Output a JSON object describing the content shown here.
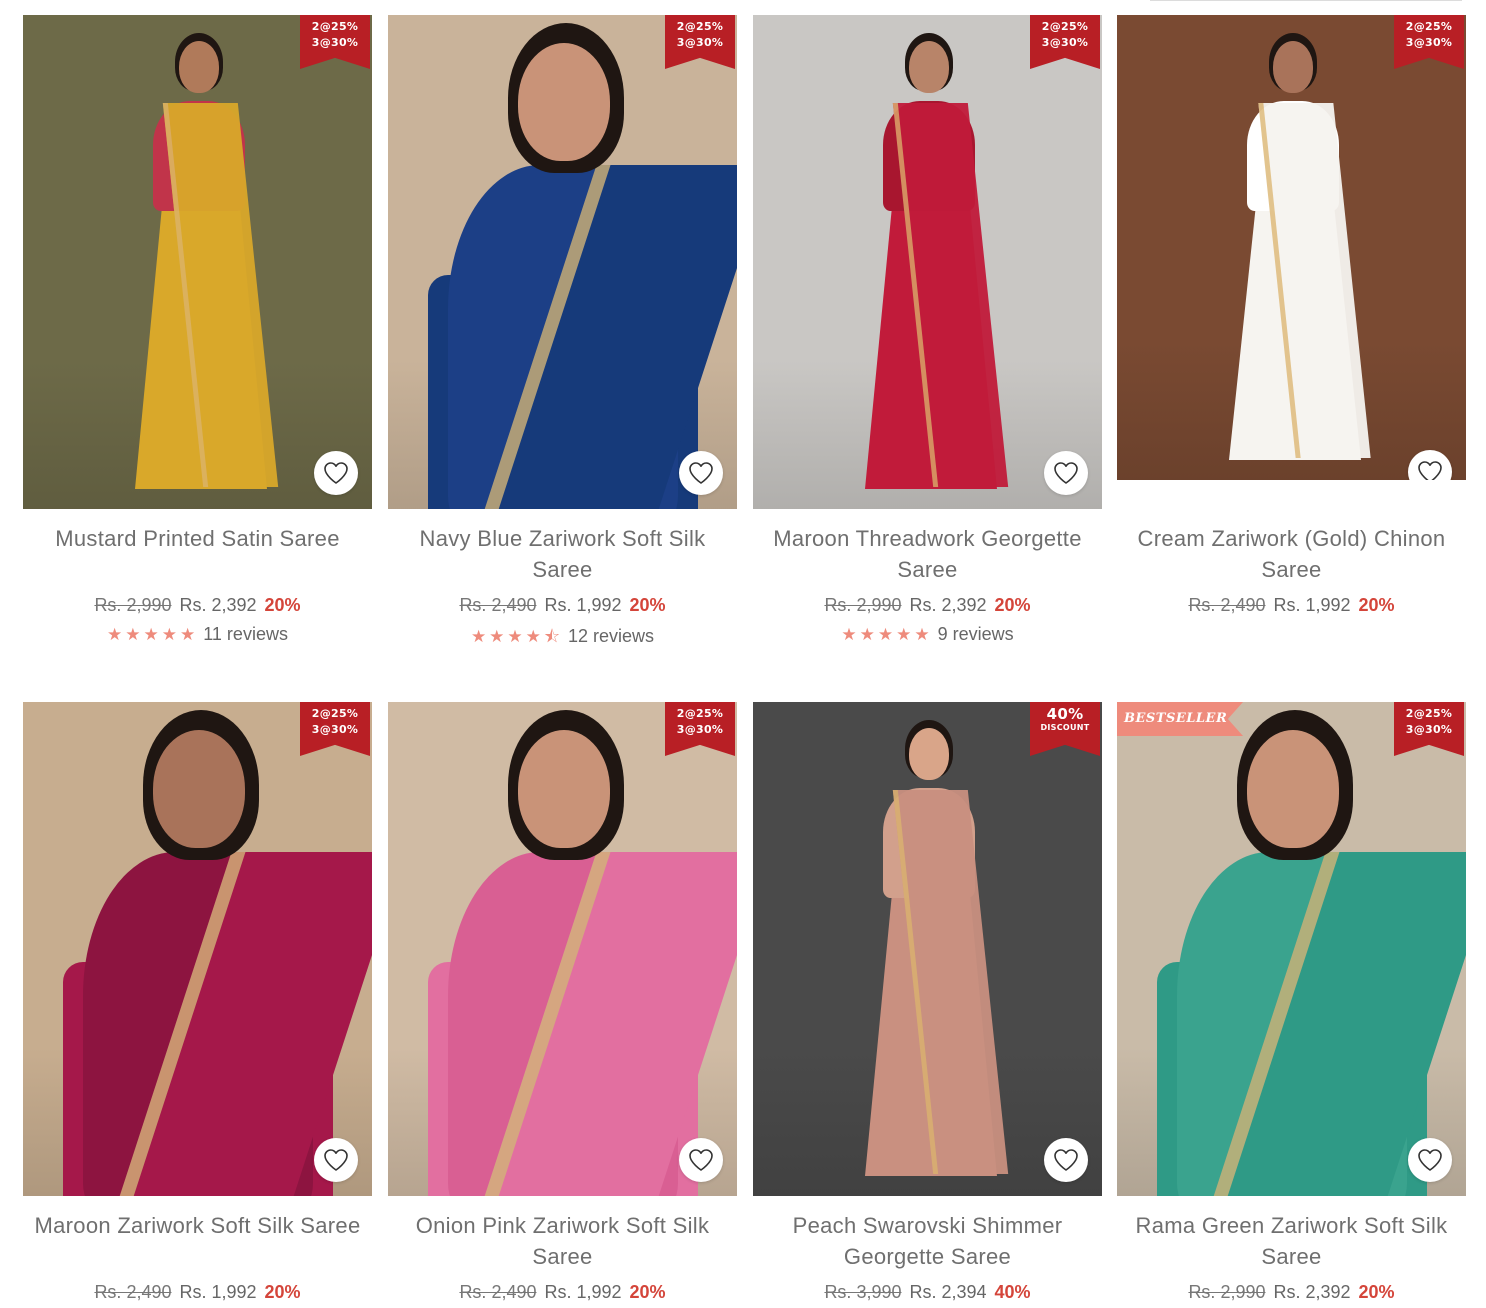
{
  "products": [
    {
      "title": "Mustard Printed Satin Saree",
      "mrp": "Rs. 2,990",
      "price": "Rs. 2,392",
      "discount": "20%",
      "stars": "★★★★★",
      "reviews": "11 reviews",
      "badge": {
        "line1": "2@25%",
        "line2": "3@30%"
      },
      "colors": {
        "bg": "#6d6a48",
        "saree": "#d9a82a",
        "blouse": "#c1344a",
        "skin": "#b07a5a"
      }
    },
    {
      "title": "Navy Blue Zariwork Soft Silk Saree",
      "mrp": "Rs. 2,490",
      "price": "Rs. 1,992",
      "discount": "20%",
      "stars": "★★★★⯪",
      "reviews": "12 reviews",
      "badge": {
        "line1": "2@25%",
        "line2": "3@30%"
      },
      "colors": {
        "bg": "#c9b39a",
        "saree": "#163a7a",
        "blouse": "#1c3f86",
        "skin": "#c99378"
      }
    },
    {
      "title": "Maroon Threadwork Georgette Saree",
      "mrp": "Rs. 2,990",
      "price": "Rs. 2,392",
      "discount": "20%",
      "stars": "★★★★★",
      "reviews": "9 reviews",
      "badge": {
        "line1": "2@25%",
        "line2": "3@30%"
      },
      "colors": {
        "bg": "#c9c7c4",
        "saree": "#c11b3a",
        "blouse": "#a8162f",
        "skin": "#b88469"
      }
    },
    {
      "title": "Cream Zariwork (Gold) Chinon Saree",
      "mrp": "Rs. 2,490",
      "price": "Rs. 1,992",
      "discount": "20%",
      "stars": "",
      "reviews": "",
      "badge": {
        "line1": "2@25%",
        "line2": "3@30%"
      },
      "colors": {
        "bg": "#7a4a32",
        "saree": "#f6f4f0",
        "blouse": "#ffffff",
        "skin": "#a9735a"
      }
    },
    {
      "title": "Maroon Zariwork Soft Silk Saree",
      "mrp": "Rs. 2,490",
      "price": "Rs. 1,992",
      "discount": "20%",
      "stars": "",
      "reviews": "",
      "badge": {
        "line1": "2@25%",
        "line2": "3@30%"
      },
      "colors": {
        "bg": "#c7ad8f",
        "saree": "#a5184a",
        "blouse": "#8d1440",
        "skin": "#a9735a"
      }
    },
    {
      "title": "Onion Pink Zariwork Soft Silk Saree",
      "mrp": "Rs. 2,490",
      "price": "Rs. 1,992",
      "discount": "20%",
      "stars": "",
      "reviews": "",
      "badge": {
        "line1": "2@25%",
        "line2": "3@30%"
      },
      "colors": {
        "bg": "#d0bba4",
        "saree": "#e26fa0",
        "blouse": "#d95f93",
        "skin": "#c99378"
      }
    },
    {
      "title": "Peach Swarovski Shimmer Georgette Saree",
      "mrp": "Rs. 3,990",
      "price": "Rs. 2,394",
      "discount": "40%",
      "stars": "",
      "reviews": "",
      "badge": {
        "line1": "40%",
        "line2": "DISCOUNT"
      },
      "colors": {
        "bg": "#4a4a4a",
        "saree": "#c99080",
        "blouse": "#d2a08c",
        "skin": "#d9a589"
      }
    },
    {
      "title": "Rama Green Zariwork Soft Silk Saree",
      "mrp": "Rs. 2,990",
      "price": "Rs. 2,392",
      "discount": "20%",
      "stars": "",
      "reviews": "",
      "badge": {
        "line1": "2@25%",
        "line2": "3@30%"
      },
      "bestseller": "BESTSELLER",
      "colors": {
        "bg": "#c9bba8",
        "saree": "#2f9a86",
        "blouse": "#3aa38e",
        "skin": "#c99378"
      }
    }
  ]
}
